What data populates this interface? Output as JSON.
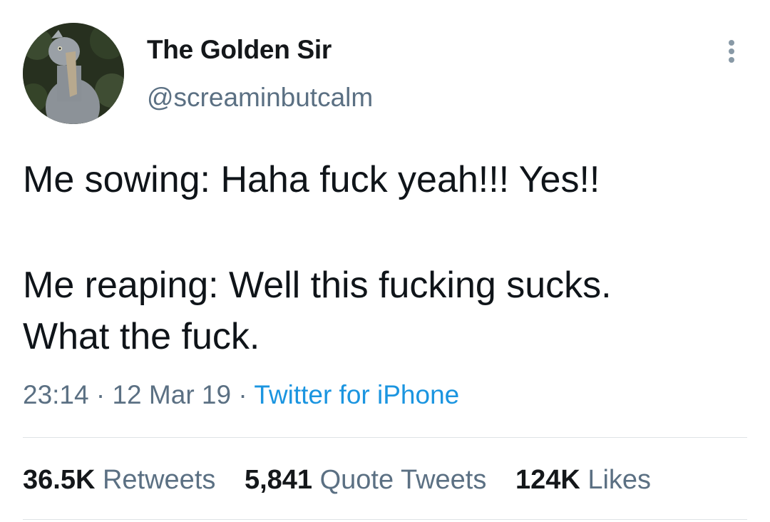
{
  "user": {
    "display_name": "The Golden Sir",
    "handle": "@screaminbutcalm",
    "avatar_icon": "shoebill-bird-avatar"
  },
  "tweet": {
    "lines": [
      "Me sowing: Haha fuck yeah!!! Yes!!",
      "Me reaping: Well this fucking sucks.",
      "What the fuck."
    ],
    "time": "23:14",
    "separator": "·",
    "date": "12 Mar 19",
    "source": "Twitter for iPhone"
  },
  "stats": {
    "retweets": {
      "count": "36.5K",
      "label": "Retweets"
    },
    "quote_tweets": {
      "count": "5,841",
      "label": "Quote Tweets"
    },
    "likes": {
      "count": "124K",
      "label": "Likes"
    }
  },
  "colors": {
    "text": "#0f1419",
    "secondary": "#5b7083",
    "link": "#1b95e0",
    "divider": "#dfe3e6"
  }
}
